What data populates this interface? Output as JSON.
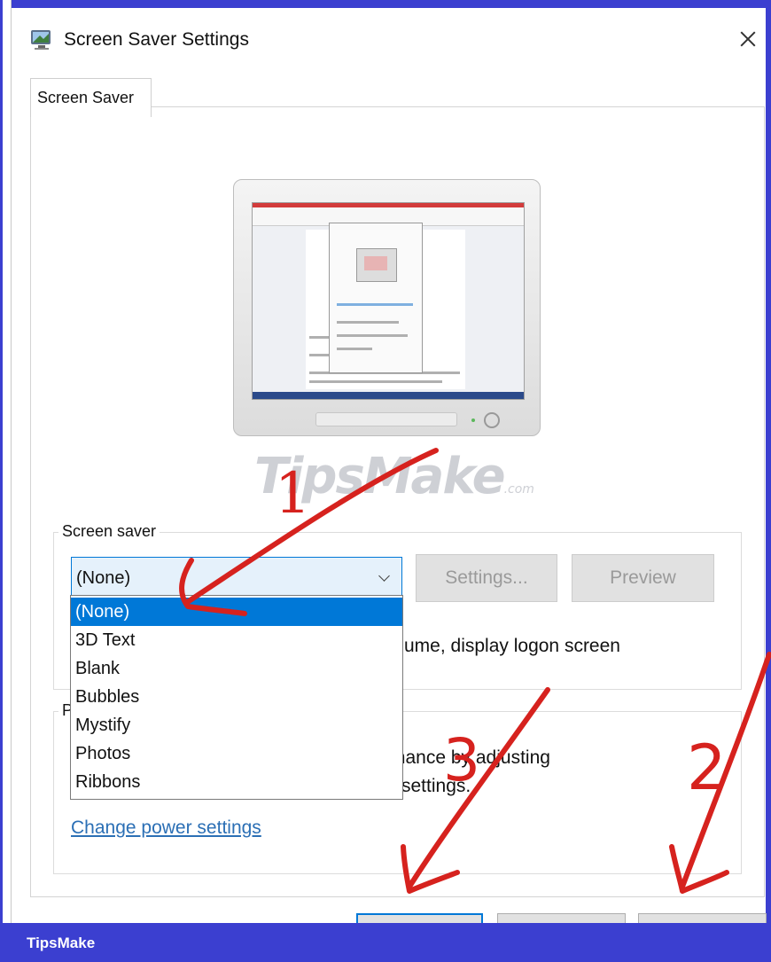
{
  "window": {
    "title": "Screen Saver Settings",
    "icon": "monitor-icon",
    "close_icon": "close-icon"
  },
  "tabs": [
    {
      "label": "Screen Saver",
      "selected": true
    }
  ],
  "watermark": {
    "text": "TipsMake",
    "suffix": ".com"
  },
  "screen_saver": {
    "group_label": "Screen saver",
    "selected": "(None)",
    "settings_label": "Settings...",
    "preview_label": "Preview",
    "resume_text": "ume, display logon screen",
    "options": [
      "(None)",
      "3D Text",
      "Blank",
      "Bubbles",
      "Mystify",
      "Photos",
      "Ribbons"
    ]
  },
  "power": {
    "group_label": "P",
    "text_line1": "mance by adjusting",
    "text_line2": "settings.",
    "link_label": "Change power settings"
  },
  "annotations": [
    "1",
    "2",
    "3"
  ],
  "brand_bar": {
    "text": "TipsMake"
  },
  "colors": {
    "frame": "#3b3fd0",
    "selection": "#0078d7",
    "link": "#2b6fb5",
    "annotation": "#d6221e"
  }
}
